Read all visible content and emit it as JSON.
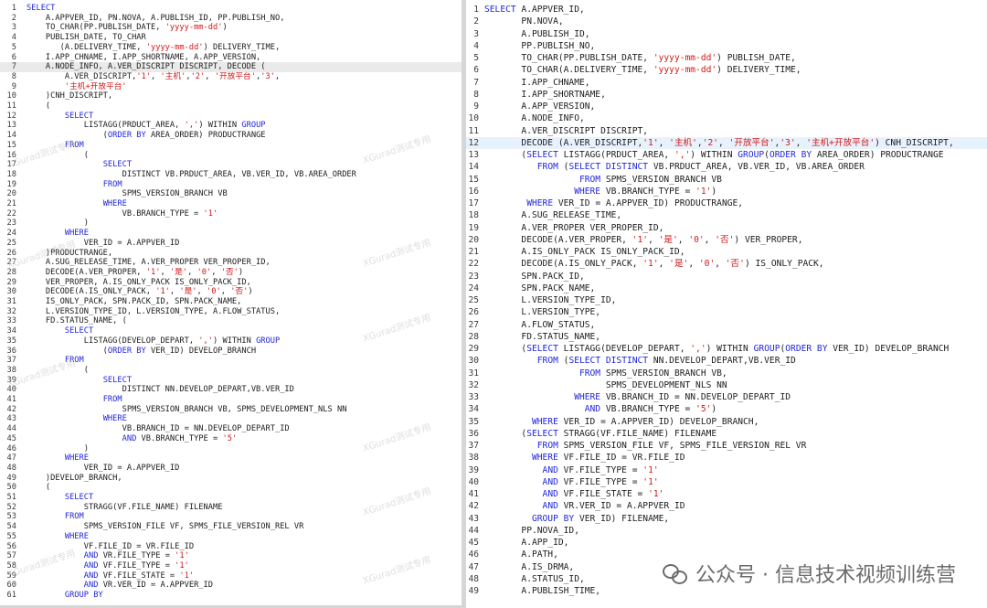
{
  "watermark": "XGurad测试专用",
  "badge_text": "公众号 · 信息技术视频训练营",
  "left_editor": {
    "highlight_line": 7,
    "lines": [
      [
        {
          "t": "SELECT",
          "c": "kw"
        }
      ],
      [
        {
          "t": "    A.APPVER_ID, PN.NOVA, A.PUBLISH_ID, PP.PUBLISH_NO,"
        }
      ],
      [
        {
          "t": "    TO_CHAR(PP.PUBLISH_DATE, "
        },
        {
          "t": "'yyyy-mm-dd'",
          "c": "str"
        },
        {
          "t": ")"
        }
      ],
      [
        {
          "t": "    PUBLISH_DATE, TO_CHAR"
        }
      ],
      [
        {
          "t": "       (A.DELIVERY_TIME, "
        },
        {
          "t": "'yyyy-mm-dd'",
          "c": "str"
        },
        {
          "t": ") DELIVERY_TIME,"
        }
      ],
      [
        {
          "t": "    I.APP_CHNAME, I.APP_SHORTNAME, A.APP_VERSION,"
        }
      ],
      [
        {
          "t": "    A.NODE_INFO, A.VER_DISCRIPT DISCRIPT, DECODE ("
        }
      ],
      [
        {
          "t": "        A.VER_DISCRIPT,"
        },
        {
          "t": "'1'",
          "c": "str"
        },
        {
          "t": ", "
        },
        {
          "t": "'主机'",
          "c": "str"
        },
        {
          "t": ","
        },
        {
          "t": "'2'",
          "c": "str"
        },
        {
          "t": ", "
        },
        {
          "t": "'开放平台'",
          "c": "str"
        },
        {
          "t": ","
        },
        {
          "t": "'3'",
          "c": "str"
        },
        {
          "t": ","
        }
      ],
      [
        {
          "t": "        "
        },
        {
          "t": "'主机+开放平台'",
          "c": "str"
        }
      ],
      [
        {
          "t": "    )CNH_DISCRIPT,"
        }
      ],
      [
        {
          "t": "    ("
        }
      ],
      [
        {
          "t": "        "
        },
        {
          "t": "SELECT",
          "c": "kw"
        }
      ],
      [
        {
          "t": "            LISTAGG(PRDUCT_AREA, "
        },
        {
          "t": "','",
          "c": "str"
        },
        {
          "t": ") WITHIN "
        },
        {
          "t": "GROUP",
          "c": "kw"
        }
      ],
      [
        {
          "t": "                ("
        },
        {
          "t": "ORDER BY",
          "c": "kw"
        },
        {
          "t": " AREA_ORDER) PRODUCTRANGE"
        }
      ],
      [
        {
          "t": "        "
        },
        {
          "t": "FROM",
          "c": "kw"
        }
      ],
      [
        {
          "t": "            ("
        }
      ],
      [
        {
          "t": "                "
        },
        {
          "t": "SELECT",
          "c": "kw"
        }
      ],
      [
        {
          "t": "                    DISTINCT VB.PRDUCT_AREA, VB.VER_ID, VB.AREA_ORDER"
        }
      ],
      [
        {
          "t": "                "
        },
        {
          "t": "FROM",
          "c": "kw"
        }
      ],
      [
        {
          "t": "                    SPMS_VERSION_BRANCH VB"
        }
      ],
      [
        {
          "t": "                "
        },
        {
          "t": "WHERE",
          "c": "kw"
        }
      ],
      [
        {
          "t": "                    VB.BRANCH_TYPE = "
        },
        {
          "t": "'1'",
          "c": "str"
        }
      ],
      [
        {
          "t": "            )"
        }
      ],
      [
        {
          "t": "        "
        },
        {
          "t": "WHERE",
          "c": "kw"
        }
      ],
      [
        {
          "t": "            VER_ID = A.APPVER_ID"
        }
      ],
      [
        {
          "t": "    )PRODUCTRANGE,"
        }
      ],
      [
        {
          "t": "    A.SUG_RELEASE_TIME, A.VER_PROPER VER_PROPER_ID,"
        }
      ],
      [
        {
          "t": "    DECODE(A.VER_PROPER, "
        },
        {
          "t": "'1'",
          "c": "str"
        },
        {
          "t": ", "
        },
        {
          "t": "'是'",
          "c": "str"
        },
        {
          "t": ", "
        },
        {
          "t": "'0'",
          "c": "str"
        },
        {
          "t": ", "
        },
        {
          "t": "'否'",
          "c": "str"
        },
        {
          "t": ")"
        }
      ],
      [
        {
          "t": "    VER_PROPER, A.IS_ONLY_PACK IS_ONLY_PACK_ID,"
        }
      ],
      [
        {
          "t": "    DECODE(A.IS_ONLY_PACK, "
        },
        {
          "t": "'1'",
          "c": "str"
        },
        {
          "t": ", "
        },
        {
          "t": "'是'",
          "c": "str"
        },
        {
          "t": ", "
        },
        {
          "t": "'0'",
          "c": "str"
        },
        {
          "t": ", "
        },
        {
          "t": "'否'",
          "c": "str"
        },
        {
          "t": ")"
        }
      ],
      [
        {
          "t": "    IS_ONLY_PACK, SPN.PACK_ID, SPN.PACK_NAME,"
        }
      ],
      [
        {
          "t": "    L.VERSION_TYPE_ID, L.VERSION_TYPE, A.FLOW_STATUS,"
        }
      ],
      [
        {
          "t": "    FD.STATUS_NAME, ("
        }
      ],
      [
        {
          "t": "        "
        },
        {
          "t": "SELECT",
          "c": "kw"
        }
      ],
      [
        {
          "t": "            LISTAGG(DEVELOP_DEPART, "
        },
        {
          "t": "','",
          "c": "str"
        },
        {
          "t": ") WITHIN "
        },
        {
          "t": "GROUP",
          "c": "kw"
        }
      ],
      [
        {
          "t": "                ("
        },
        {
          "t": "ORDER BY",
          "c": "kw"
        },
        {
          "t": " VER_ID) DEVELOP_BRANCH"
        }
      ],
      [
        {
          "t": "        "
        },
        {
          "t": "FROM",
          "c": "kw"
        }
      ],
      [
        {
          "t": "            ("
        }
      ],
      [
        {
          "t": "                "
        },
        {
          "t": "SELECT",
          "c": "kw"
        }
      ],
      [
        {
          "t": "                    DISTINCT NN.DEVELOP_DEPART,VB.VER_ID"
        }
      ],
      [
        {
          "t": "                "
        },
        {
          "t": "FROM",
          "c": "kw"
        }
      ],
      [
        {
          "t": "                    SPMS_VERSION_BRANCH VB, SPMS_DEVELOPMENT_NLS NN"
        }
      ],
      [
        {
          "t": "                "
        },
        {
          "t": "WHERE",
          "c": "kw"
        }
      ],
      [
        {
          "t": "                    VB.BRANCH_ID = NN.DEVELOP_DEPART_ID"
        }
      ],
      [
        {
          "t": "                    "
        },
        {
          "t": "AND",
          "c": "kw"
        },
        {
          "t": " VB.BRANCH_TYPE = "
        },
        {
          "t": "'5'",
          "c": "str"
        }
      ],
      [
        {
          "t": "            )"
        }
      ],
      [
        {
          "t": "        "
        },
        {
          "t": "WHERE",
          "c": "kw"
        }
      ],
      [
        {
          "t": "            VER_ID = A.APPVER_ID"
        }
      ],
      [
        {
          "t": "    )DEVELOP_BRANCH,"
        }
      ],
      [
        {
          "t": "    ("
        }
      ],
      [
        {
          "t": "        "
        },
        {
          "t": "SELECT",
          "c": "kw"
        }
      ],
      [
        {
          "t": "            STRAGG(VF.FILE_NAME) FILENAME"
        }
      ],
      [
        {
          "t": "        "
        },
        {
          "t": "FROM",
          "c": "kw"
        }
      ],
      [
        {
          "t": "            SPMS_VERSION_FILE VF, SPMS_FILE_VERSION_REL VR"
        }
      ],
      [
        {
          "t": "        "
        },
        {
          "t": "WHERE",
          "c": "kw"
        }
      ],
      [
        {
          "t": "            VF.FILE_ID = VR.FILE_ID"
        }
      ],
      [
        {
          "t": "            "
        },
        {
          "t": "AND",
          "c": "kw"
        },
        {
          "t": " VR.FILE_TYPE = "
        },
        {
          "t": "'1'",
          "c": "str"
        }
      ],
      [
        {
          "t": "            "
        },
        {
          "t": "AND",
          "c": "kw"
        },
        {
          "t": " VF.FILE_TYPE = "
        },
        {
          "t": "'1'",
          "c": "str"
        }
      ],
      [
        {
          "t": "            "
        },
        {
          "t": "AND",
          "c": "kw"
        },
        {
          "t": " VF.FILE_STATE = "
        },
        {
          "t": "'1'",
          "c": "str"
        }
      ],
      [
        {
          "t": "            "
        },
        {
          "t": "AND",
          "c": "kw"
        },
        {
          "t": " VR.VER_ID = A.APPVER_ID"
        }
      ],
      [
        {
          "t": "        "
        },
        {
          "t": "GROUP BY",
          "c": "kw"
        }
      ]
    ]
  },
  "right_editor": {
    "highlight_line": 12,
    "lines": [
      [
        {
          "t": "SELECT",
          "c": "kw"
        },
        {
          "t": " A.APPVER_ID,"
        }
      ],
      [
        {
          "t": "       PN.NOVA,"
        }
      ],
      [
        {
          "t": "       A.PUBLISH_ID,"
        }
      ],
      [
        {
          "t": "       PP.PUBLISH_NO,"
        }
      ],
      [
        {
          "t": "       TO_CHAR(PP.PUBLISH_DATE, "
        },
        {
          "t": "'yyyy-mm-dd'",
          "c": "str"
        },
        {
          "t": ") PUBLISH_DATE,"
        }
      ],
      [
        {
          "t": "       TO_CHAR(A.DELIVERY_TIME, "
        },
        {
          "t": "'yyyy-mm-dd'",
          "c": "str"
        },
        {
          "t": ") DELIVERY_TIME,"
        }
      ],
      [
        {
          "t": "       I.APP_CHNAME,"
        }
      ],
      [
        {
          "t": "       I.APP_SHORTNAME,"
        }
      ],
      [
        {
          "t": "       A.APP_VERSION,"
        }
      ],
      [
        {
          "t": "       A.NODE_INFO,"
        }
      ],
      [
        {
          "t": "       A.VER_DISCRIPT DISCRIPT,"
        }
      ],
      [
        {
          "t": "       DECODE (A.VER_DISCRIPT,"
        },
        {
          "t": "'1'",
          "c": "str"
        },
        {
          "t": ", "
        },
        {
          "t": "'主机'",
          "c": "str"
        },
        {
          "t": ","
        },
        {
          "t": "'2'",
          "c": "str"
        },
        {
          "t": ", "
        },
        {
          "t": "'开放平台'",
          "c": "str"
        },
        {
          "t": ","
        },
        {
          "t": "'3'",
          "c": "str"
        },
        {
          "t": ", "
        },
        {
          "t": "'主机+开放平台'",
          "c": "str"
        },
        {
          "t": ") CNH_DISCRIPT,"
        }
      ],
      [
        {
          "t": "       ("
        },
        {
          "t": "SELECT",
          "c": "kw"
        },
        {
          "t": " LISTAGG(PRDUCT_AREA, "
        },
        {
          "t": "','",
          "c": "str"
        },
        {
          "t": ") WITHIN "
        },
        {
          "t": "GROUP",
          "c": "kw"
        },
        {
          "t": "("
        },
        {
          "t": "ORDER BY",
          "c": "kw"
        },
        {
          "t": " AREA_ORDER) PRODUCTRANGE"
        }
      ],
      [
        {
          "t": "          "
        },
        {
          "t": "FROM",
          "c": "kw"
        },
        {
          "t": " ("
        },
        {
          "t": "SELECT DISTINCT",
          "c": "kw"
        },
        {
          "t": " VB.PRDUCT_AREA, VB.VER_ID, VB.AREA_ORDER"
        }
      ],
      [
        {
          "t": "                  "
        },
        {
          "t": "FROM",
          "c": "kw"
        },
        {
          "t": " SPMS_VERSION_BRANCH VB"
        }
      ],
      [
        {
          "t": "                 "
        },
        {
          "t": "WHERE",
          "c": "kw"
        },
        {
          "t": " VB.BRANCH_TYPE = "
        },
        {
          "t": "'1'",
          "c": "str"
        },
        {
          "t": ")"
        }
      ],
      [
        {
          "t": "        "
        },
        {
          "t": "WHERE",
          "c": "kw"
        },
        {
          "t": " VER_ID = A.APPVER_ID) PRODUCTRANGE,"
        }
      ],
      [
        {
          "t": "       A.SUG_RELEASE_TIME,"
        }
      ],
      [
        {
          "t": "       A.VER_PROPER VER_PROPER_ID,"
        }
      ],
      [
        {
          "t": "       DECODE(A.VER_PROPER, "
        },
        {
          "t": "'1'",
          "c": "str"
        },
        {
          "t": ", "
        },
        {
          "t": "'是'",
          "c": "str"
        },
        {
          "t": ", "
        },
        {
          "t": "'0'",
          "c": "str"
        },
        {
          "t": ", "
        },
        {
          "t": "'否'",
          "c": "str"
        },
        {
          "t": ") VER_PROPER,"
        }
      ],
      [
        {
          "t": "       A.IS_ONLY_PACK IS_ONLY_PACK_ID,"
        }
      ],
      [
        {
          "t": "       DECODE(A.IS_ONLY_PACK, "
        },
        {
          "t": "'1'",
          "c": "str"
        },
        {
          "t": ", "
        },
        {
          "t": "'是'",
          "c": "str"
        },
        {
          "t": ", "
        },
        {
          "t": "'0'",
          "c": "str"
        },
        {
          "t": ", "
        },
        {
          "t": "'否'",
          "c": "str"
        },
        {
          "t": ") IS_ONLY_PACK,"
        }
      ],
      [
        {
          "t": "       SPN.PACK_ID,"
        }
      ],
      [
        {
          "t": "       SPN.PACK_NAME,"
        }
      ],
      [
        {
          "t": "       L.VERSION_TYPE_ID,"
        }
      ],
      [
        {
          "t": "       L.VERSION_TYPE,"
        }
      ],
      [
        {
          "t": "       A.FLOW_STATUS,"
        }
      ],
      [
        {
          "t": "       FD.STATUS_NAME,"
        }
      ],
      [
        {
          "t": "       ("
        },
        {
          "t": "SELECT",
          "c": "kw"
        },
        {
          "t": " LISTAGG(DEVELOP_DEPART, "
        },
        {
          "t": "','",
          "c": "str"
        },
        {
          "t": ") WITHIN "
        },
        {
          "t": "GROUP",
          "c": "kw"
        },
        {
          "t": "("
        },
        {
          "t": "ORDER BY",
          "c": "kw"
        },
        {
          "t": " VER_ID) DEVELOP_BRANCH"
        }
      ],
      [
        {
          "t": "          "
        },
        {
          "t": "FROM",
          "c": "kw"
        },
        {
          "t": " ("
        },
        {
          "t": "SELECT DISTINCT",
          "c": "kw"
        },
        {
          "t": " NN.DEVELOP_DEPART,VB.VER_ID"
        }
      ],
      [
        {
          "t": "                  "
        },
        {
          "t": "FROM",
          "c": "kw"
        },
        {
          "t": " SPMS_VERSION_BRANCH VB,"
        }
      ],
      [
        {
          "t": "                       SPMS_DEVELOPMENT_NLS NN"
        }
      ],
      [
        {
          "t": "                 "
        },
        {
          "t": "WHERE",
          "c": "kw"
        },
        {
          "t": " VB.BRANCH_ID = NN.DEVELOP_DEPART_ID"
        }
      ],
      [
        {
          "t": "                   "
        },
        {
          "t": "AND",
          "c": "kw"
        },
        {
          "t": " VB.BRANCH_TYPE = "
        },
        {
          "t": "'5'",
          "c": "str"
        },
        {
          "t": ")"
        }
      ],
      [
        {
          "t": "         "
        },
        {
          "t": "WHERE",
          "c": "kw"
        },
        {
          "t": " VER_ID = A.APPVER_ID) DEVELOP_BRANCH,"
        }
      ],
      [
        {
          "t": "       ("
        },
        {
          "t": "SELECT",
          "c": "kw"
        },
        {
          "t": " STRAGG(VF.FILE_NAME) FILENAME"
        }
      ],
      [
        {
          "t": "          "
        },
        {
          "t": "FROM",
          "c": "kw"
        },
        {
          "t": " SPMS_VERSION_FILE VF, SPMS_FILE_VERSION_REL VR"
        }
      ],
      [
        {
          "t": "         "
        },
        {
          "t": "WHERE",
          "c": "kw"
        },
        {
          "t": " VF.FILE_ID = VR.FILE_ID"
        }
      ],
      [
        {
          "t": "           "
        },
        {
          "t": "AND",
          "c": "kw"
        },
        {
          "t": " VF.FILE_TYPE = "
        },
        {
          "t": "'1'",
          "c": "str"
        }
      ],
      [
        {
          "t": "           "
        },
        {
          "t": "AND",
          "c": "kw"
        },
        {
          "t": " VF.FILE_TYPE = "
        },
        {
          "t": "'1'",
          "c": "str"
        }
      ],
      [
        {
          "t": "           "
        },
        {
          "t": "AND",
          "c": "kw"
        },
        {
          "t": " VF.FILE_STATE = "
        },
        {
          "t": "'1'",
          "c": "str"
        }
      ],
      [
        {
          "t": "           "
        },
        {
          "t": "AND",
          "c": "kw"
        },
        {
          "t": " VR.VER_ID = A.APPVER_ID"
        }
      ],
      [
        {
          "t": "         "
        },
        {
          "t": "GROUP BY",
          "c": "kw"
        },
        {
          "t": " VER_ID) FILENAME,"
        }
      ],
      [
        {
          "t": "       PP.NOVA_ID,"
        }
      ],
      [
        {
          "t": "       A.APP_ID,"
        }
      ],
      [
        {
          "t": "       A.PATH,"
        }
      ],
      [
        {
          "t": "       A.IS_DRMA,"
        }
      ],
      [
        {
          "t": "       A.STATUS_ID,"
        }
      ],
      [
        {
          "t": "       A.PUBLISH_TIME,"
        }
      ]
    ]
  }
}
